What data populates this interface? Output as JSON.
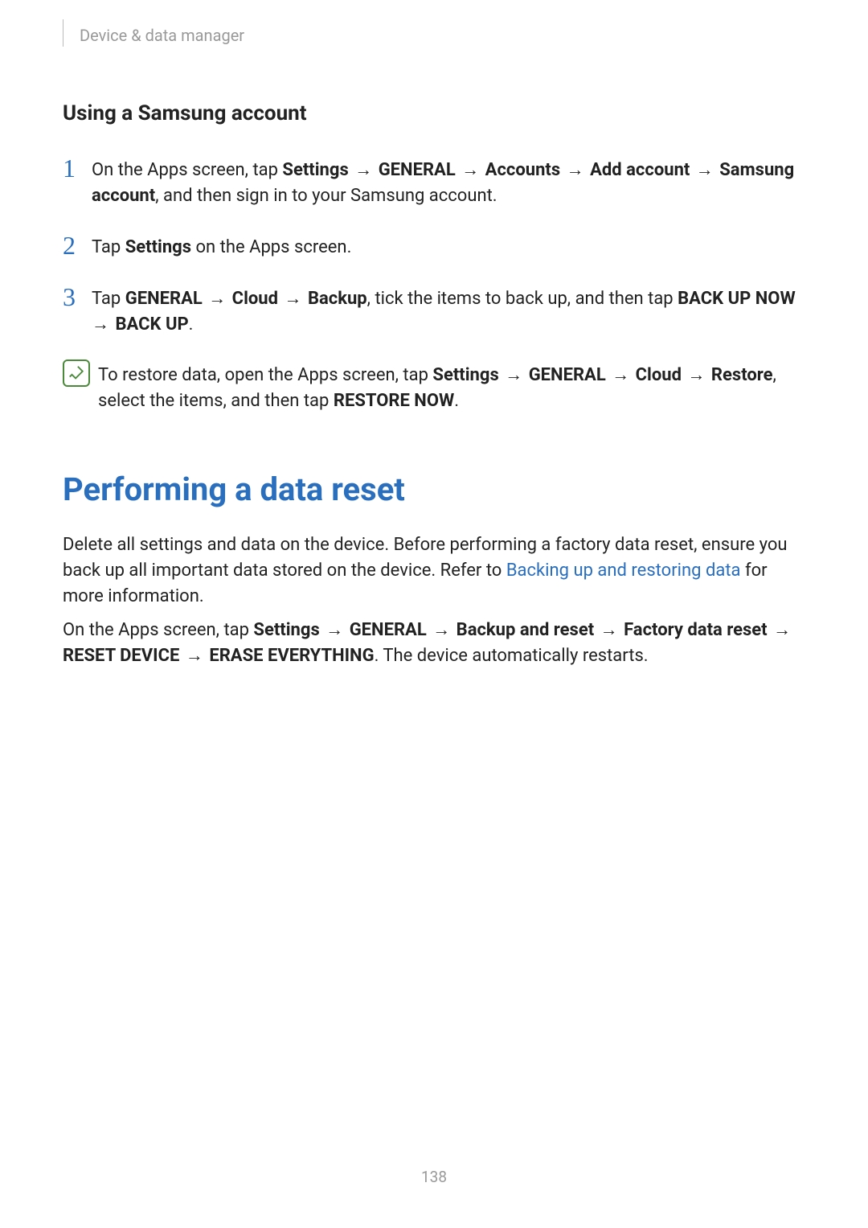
{
  "header": {
    "breadcrumb": "Device & data manager"
  },
  "section1": {
    "title": "Using a Samsung account",
    "steps": {
      "s1": {
        "num": "1",
        "pre": "On the Apps screen, tap ",
        "b1": "Settings",
        "arr1": " → ",
        "b2": "GENERAL",
        "arr2": " → ",
        "b3": "Accounts",
        "arr3": " → ",
        "b4": "Add account",
        "arr4": " → ",
        "b5": "Samsung account",
        "post": ", and then sign in to your Samsung account."
      },
      "s2": {
        "num": "2",
        "pre": "Tap ",
        "b1": "Settings",
        "post": " on the Apps screen."
      },
      "s3": {
        "num": "3",
        "pre": "Tap ",
        "b1": "GENERAL",
        "arr1": " → ",
        "b2": "Cloud",
        "arr2": " → ",
        "b3": "Backup",
        "mid": ", tick the items to back up, and then tap ",
        "b4": "BACK UP NOW",
        "arr3": " → ",
        "b5": "BACK UP",
        "post": "."
      }
    },
    "note": {
      "pre": "To restore data, open the Apps screen, tap ",
      "b1": "Settings",
      "arr1": " → ",
      "b2": "GENERAL",
      "arr2": " → ",
      "b3": "Cloud",
      "arr3": " → ",
      "b4": "Restore",
      "mid": ", select the items, and then tap ",
      "b5": "RESTORE NOW",
      "post": "."
    }
  },
  "section2": {
    "heading": "Performing a data reset",
    "p1": {
      "t1": "Delete all settings and data on the device. Before performing a factory data reset, ensure you back up all important data stored on the device. Refer to ",
      "link": "Backing up and restoring data",
      "t2": " for more information."
    },
    "p2": {
      "pre": "On the Apps screen, tap ",
      "b1": "Settings",
      "arr1": " → ",
      "b2": "GENERAL",
      "arr2": " → ",
      "b3": "Backup and reset",
      "arr3": " → ",
      "b4": "Factory data reset",
      "arr4": " → ",
      "b5": "RESET DEVICE",
      "arr5": " → ",
      "b6": "ERASE EVERYTHING",
      "post": ". The device automatically restarts."
    }
  },
  "page_number": "138"
}
